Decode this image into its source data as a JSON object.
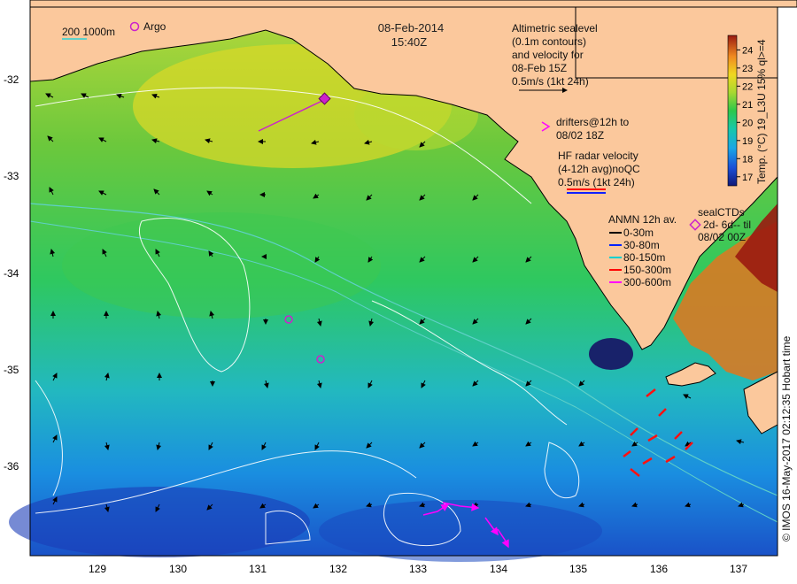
{
  "title": {
    "date": "08-Feb-2014",
    "time": "15:40Z"
  },
  "bathymetry_legend": {
    "label": "200  1000m",
    "swatch_color": "#5fd0c8"
  },
  "argo_legend": {
    "label": "Argo",
    "color": "#cc22cc"
  },
  "altimetry": {
    "line1": "Altimetric sealevel",
    "line2": "(0.1m contours)",
    "line3": "and velocity for",
    "line4": "08-Feb 15Z",
    "scale": "0.5m/s (1kt 24h)"
  },
  "drifters": {
    "line1": "drifters@12h to",
    "line2": "08/02 18Z",
    "color": "#ff00ff"
  },
  "hf_radar": {
    "line1": "HF radar velocity",
    "line2": "(4-12h avg)noQC",
    "line3": "0.5m/s (1kt 24h)"
  },
  "anmn": {
    "title": "ANMN 12h av.",
    "items": [
      {
        "label": "0-30m",
        "color": "#000000"
      },
      {
        "label": "30-80m",
        "color": "#0022ff"
      },
      {
        "label": "80-150m",
        "color": "#00d0d0"
      },
      {
        "label": "150-300m",
        "color": "#ff0000"
      },
      {
        "label": "300-600m",
        "color": "#ff00ff"
      }
    ]
  },
  "seal_ctds": {
    "title": "sealCTDs",
    "line1": "2d- 6d-- til",
    "line2": "08/02 00Z",
    "color": "#cc22cc"
  },
  "colorbar": {
    "title": "Temp. (°C) 19_L3U 15% ql>=4",
    "ticks": [
      "17",
      "18",
      "19",
      "20",
      "21",
      "22",
      "23",
      "24"
    ],
    "min": 16.5,
    "max": 24.8
  },
  "credit": "© IMOS 16-May-2017 02:12:35 Hobart time",
  "axes": {
    "x_ticks": [
      "129",
      "130",
      "131",
      "132",
      "133",
      "134",
      "135",
      "136",
      "137"
    ],
    "y_ticks": [
      "-32",
      "-33",
      "-34",
      "-35",
      "-36"
    ]
  }
}
